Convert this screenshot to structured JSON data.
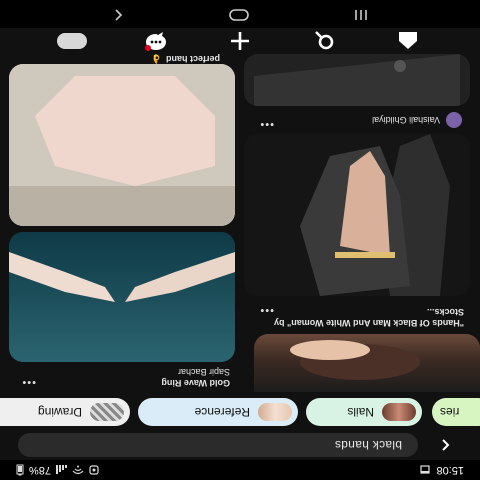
{
  "status_bar": {
    "time": "15:08",
    "battery": "78%"
  },
  "search": {
    "query": "black hands"
  },
  "chips": [
    {
      "label": "Drawing"
    },
    {
      "label": "Reference"
    },
    {
      "label": "Nails"
    },
    {
      "label": "ries"
    }
  ],
  "pins": [
    {
      "title": "\"Hands Of Black Man And White Woman\" by Stocks..."
    },
    {
      "title": "Gold Wave Ring",
      "author": "Sapir Bachar"
    },
    {
      "author": "Vaishali Ghildiyal"
    },
    {
      "title": "perfect hand",
      "emoji": "👌"
    }
  ],
  "more_label": "•••",
  "icons": {
    "back": "back-arrow-icon",
    "home": "home-icon",
    "search": "search-icon",
    "create": "plus-icon",
    "messages": "chat-icon",
    "profile": "profile-avatar",
    "sys_recents": "recents-icon",
    "sys_home": "home-circle-icon",
    "sys_back": "system-back-icon"
  },
  "colors": {
    "background": "#111111",
    "search_box": "#2b2b2b",
    "chip_drawing": "#efefef",
    "chip_reference": "#d9ecf7",
    "chip_nails": "#d8f3e3",
    "chip_series": "#d6f5c0"
  }
}
